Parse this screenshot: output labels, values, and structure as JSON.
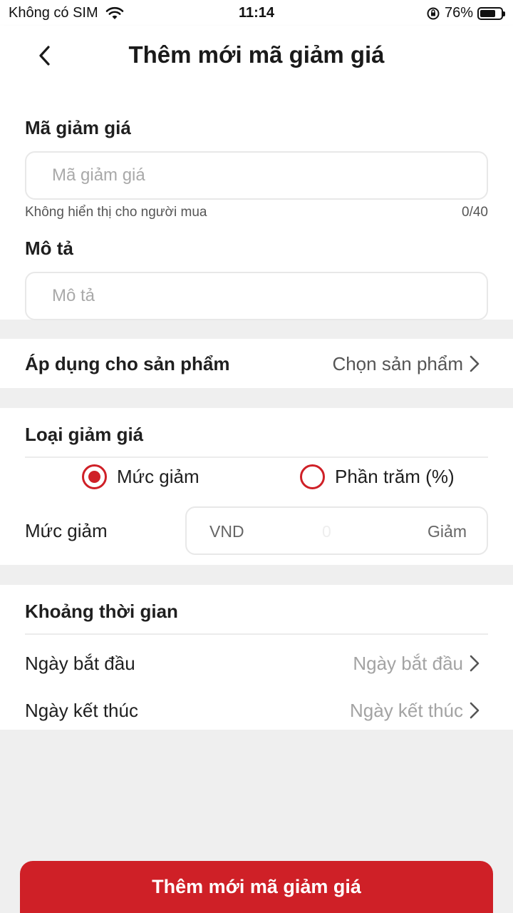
{
  "status_bar": {
    "carrier": "Không có SIM",
    "time": "11:14",
    "battery": "76%",
    "battery_level": 0.76
  },
  "header": {
    "title": "Thêm mới mã giảm giá"
  },
  "code": {
    "label": "Mã giảm giá",
    "placeholder": "Mã giảm giá",
    "hint": "Không hiển thị cho người mua",
    "counter": "0/40"
  },
  "description": {
    "label": "Mô tả",
    "placeholder": "Mô tả"
  },
  "apply_products": {
    "label": "Áp dụng cho sản phẩm",
    "value": "Chọn sản phẩm"
  },
  "discount_type": {
    "label": "Loại giảm giá",
    "options": [
      {
        "label": "Mức giảm",
        "selected": true
      },
      {
        "label": "Phần trăm (%)",
        "selected": false
      }
    ],
    "amount_label": "Mức giảm",
    "amount_unit": "VND",
    "amount_value": "0",
    "amount_suffix": "Giảm"
  },
  "period": {
    "label": "Khoảng thời gian",
    "start_label": "Ngày bắt đầu",
    "start_placeholder": "Ngày bắt đầu",
    "end_label": "Ngày kết thúc",
    "end_placeholder": "Ngày kết thúc"
  },
  "submit_label": "Thêm mới mã giảm giá",
  "colors": {
    "accent": "#cf2027",
    "background": "#efefef"
  }
}
